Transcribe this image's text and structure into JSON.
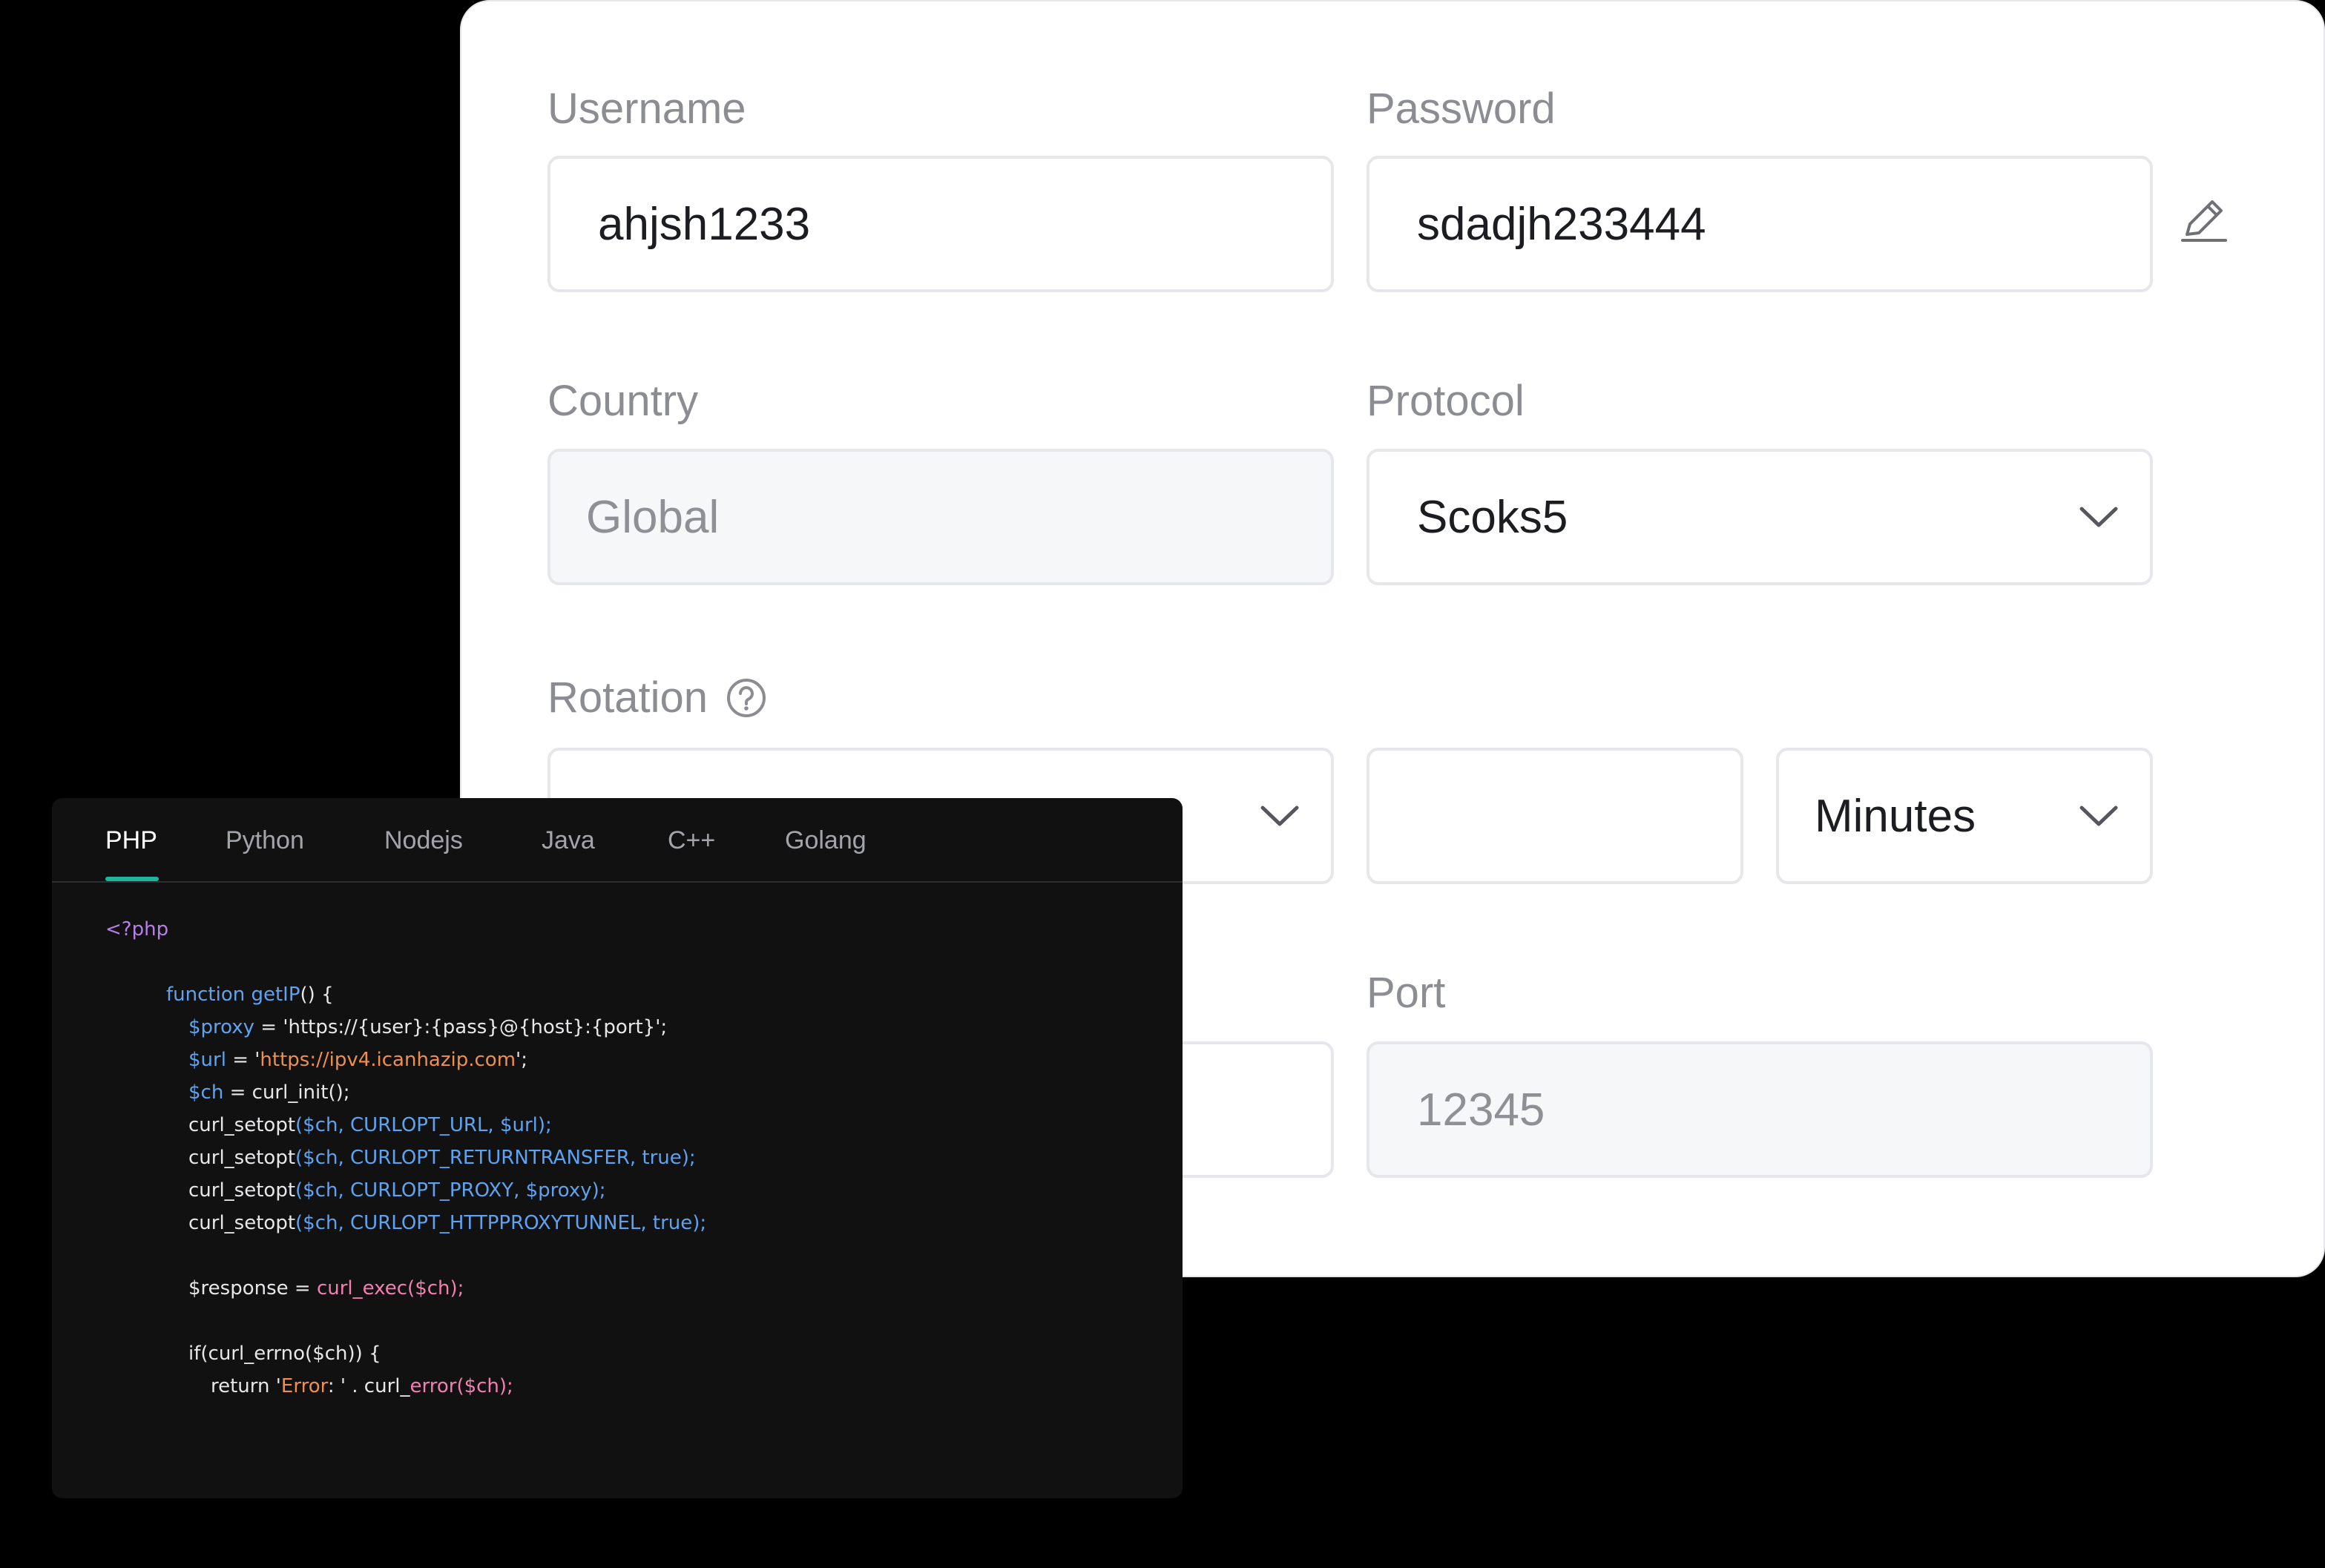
{
  "form": {
    "username": {
      "label": "Username",
      "value": "ahjsh1233"
    },
    "password": {
      "label": "Password",
      "value": "sdadjh233444"
    },
    "country": {
      "label": "Country",
      "value": "Global"
    },
    "protocol": {
      "label": "Protocol",
      "value": "Scoks5"
    },
    "rotation": {
      "label": "Rotation",
      "select_value": "",
      "amount_value": "",
      "unit_value": "Minutes"
    },
    "host": {
      "value": ""
    },
    "port": {
      "label": "Port",
      "value": "12345"
    }
  },
  "icons": {
    "edit": "pencil-icon",
    "help": "question-circle-icon",
    "chevron": "chevron-down-icon"
  },
  "colors": {
    "accent": "#1fb59a",
    "code_background": "#111112",
    "keyword": "#5fa3f0",
    "string": "#f08f4d",
    "tag": "#b87fe8",
    "func": "#f27fb0"
  },
  "code_panel": {
    "tabs": [
      "PHP",
      "Python",
      "Nodejs",
      "Java",
      "C++",
      "Golang"
    ],
    "active_tab": "PHP",
    "lines": [
      {
        "indent": 0,
        "parts": [
          {
            "t": "<?php",
            "c": "purple"
          }
        ]
      },
      {
        "indent": 0,
        "parts": []
      },
      {
        "indent": 1,
        "parts": [
          {
            "t": "function getIP",
            "c": "blue"
          },
          {
            "t": "() {",
            "c": "white"
          }
        ]
      },
      {
        "indent": 2,
        "parts": [
          {
            "t": "$proxy",
            "c": "blue"
          },
          {
            "t": " = 'https://{user}:{pass}@{host}:{port}';",
            "c": "white"
          }
        ]
      },
      {
        "indent": 2,
        "parts": [
          {
            "t": "$url",
            "c": "blue"
          },
          {
            "t": " = '",
            "c": "white"
          },
          {
            "t": "https://ipv4.icanhazip.com",
            "c": "orange"
          },
          {
            "t": "';",
            "c": "white"
          }
        ]
      },
      {
        "indent": 2,
        "parts": [
          {
            "t": "$ch",
            "c": "blue"
          },
          {
            "t": " = curl_init();",
            "c": "white"
          }
        ]
      },
      {
        "indent": 2,
        "parts": [
          {
            "t": "curl_setopt",
            "c": "white"
          },
          {
            "t": "($ch, CURLOPT_URL, $url);",
            "c": "blue"
          }
        ]
      },
      {
        "indent": 2,
        "parts": [
          {
            "t": "curl_setopt",
            "c": "white"
          },
          {
            "t": "($ch, CURLOPT_RETURNTRANSFER, true);",
            "c": "blue"
          }
        ]
      },
      {
        "indent": 2,
        "parts": [
          {
            "t": "curl_setopt",
            "c": "white"
          },
          {
            "t": "($ch, CURLOPT_PROXY, $proxy);",
            "c": "blue"
          }
        ]
      },
      {
        "indent": 2,
        "parts": [
          {
            "t": "curl_setopt",
            "c": "white"
          },
          {
            "t": "($ch, CURLOPT_HTTPPROXYTUNNEL, true);",
            "c": "blue"
          }
        ]
      },
      {
        "indent": 0,
        "parts": []
      },
      {
        "indent": 2,
        "parts": [
          {
            "t": "$response = ",
            "c": "white"
          },
          {
            "t": "curl_exec($ch);",
            "c": "pink"
          }
        ]
      },
      {
        "indent": 0,
        "parts": []
      },
      {
        "indent": 2,
        "parts": [
          {
            "t": "if(curl_errno($ch)) {",
            "c": "white"
          }
        ]
      },
      {
        "indent": 3,
        "parts": [
          {
            "t": "return '",
            "c": "white"
          },
          {
            "t": "Error",
            "c": "orange"
          },
          {
            "t": ": ' . curl_",
            "c": "white"
          },
          {
            "t": "error($ch);",
            "c": "pink"
          }
        ]
      }
    ]
  }
}
